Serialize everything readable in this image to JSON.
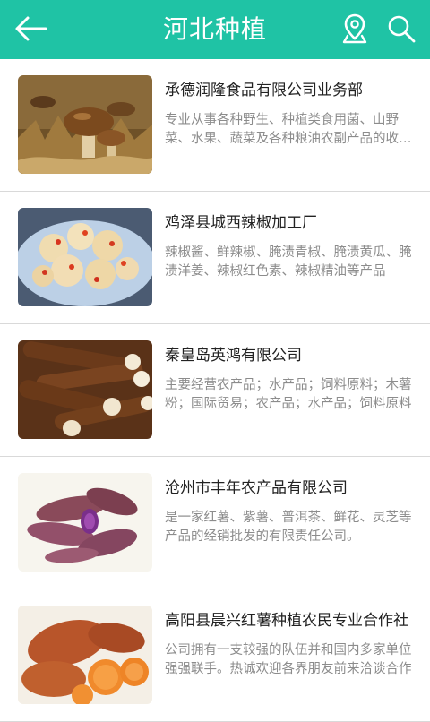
{
  "header": {
    "title": "河北种植",
    "back_icon": "arrow-left-icon",
    "location_icon": "map-pin-icon",
    "search_icon": "search-icon",
    "color": "#1fc3a5"
  },
  "companies": [
    {
      "name": "承德润隆食品有限公司业务部",
      "desc": "专业从事各种野生、种植类食用菌、山野菜、水果、蔬菜及各种粮油农副产品的收购加工",
      "image": "mushroom-photo"
    },
    {
      "name": "鸡泽县城西辣椒加工厂",
      "desc": "辣椒酱、鲜辣椒、腌渍青椒、腌渍黄瓜、腌渍洋姜、辣椒红色素、辣椒精油等产品",
      "image": "pickled-chili-photo"
    },
    {
      "name": " 秦皇岛英鸿有限公司",
      "desc": "主要经营农产品；水产品；饲料原料；木薯粉；国际贸易；农产品；水产品；饲料原料",
      "image": "cassava-photo"
    },
    {
      "name": " 沧州市丰年农产品有限公司",
      "desc": "是一家红薯、紫薯、普洱茶、鲜花、灵芝等产品的经销批发的有限责任公司。",
      "image": "purple-sweet-potato-photo"
    },
    {
      "name": "高阳县晨兴红薯种植农民专业合作社",
      "desc": "公司拥有一支较强的队伍并和国内多家单位强强联手。热诚欢迎各界朋友前来洽谈合作",
      "image": "sweet-potato-photo"
    }
  ]
}
